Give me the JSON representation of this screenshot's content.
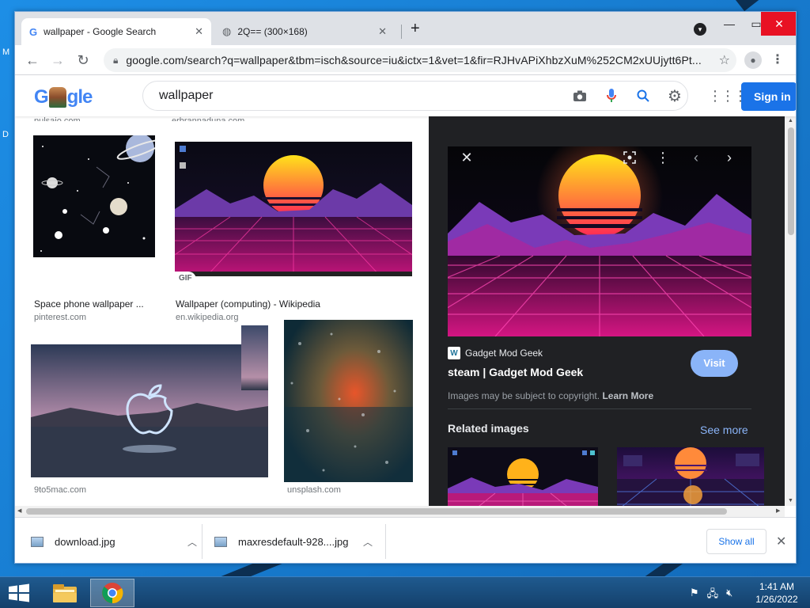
{
  "desktop": {
    "label_top": "M",
    "label_mid": "D"
  },
  "tabs": [
    {
      "title": "wallpaper - Google Search",
      "favicon": "google-g-icon",
      "active": true
    },
    {
      "title": "2Q== (300×168)",
      "favicon": "globe-icon",
      "active": false
    }
  ],
  "toolbar": {
    "url": "google.com/search?q=wallpaper&tbm=isch&source=iu&ictx=1&vet=1&fir=RJHvAPiXhbzXuM%252CM2xUUjytt6Pt..."
  },
  "google": {
    "logo_letters": [
      "G",
      "gle"
    ],
    "query": "wallpaper",
    "signin_label": "Sign in"
  },
  "results": {
    "cut_titles": [
      "pulsaio.com",
      "erbrannaduna.com"
    ],
    "items": [
      {
        "title": "Space phone wallpaper ...",
        "source": "pinterest.com"
      },
      {
        "title": "Wallpaper (computing) - Wikipedia",
        "source": "en.wikipedia.org",
        "badge": "GIF"
      },
      {
        "title": "",
        "source": "9to5mac.com"
      },
      {
        "title": "",
        "source": "unsplash.com"
      }
    ]
  },
  "preview": {
    "site_name": "Gadget Mod Geek",
    "title": "steam | Gadget Mod Geek",
    "visit_label": "Visit",
    "copyright_text": "Images may be subject to copyright.",
    "learn_more": "Learn More",
    "related_title": "Related images",
    "see_more": "See more"
  },
  "downloads": {
    "items": [
      {
        "name": "download.jpg"
      },
      {
        "name": "maxresdefault-928....jpg"
      }
    ],
    "show_all": "Show all"
  },
  "taskbar": {
    "time": "1:41 AM",
    "date": "1/26/2022"
  },
  "colors": {
    "accent": "#1a73e8",
    "preview_bg": "#202124",
    "taskbar": "#1f5a8f"
  }
}
